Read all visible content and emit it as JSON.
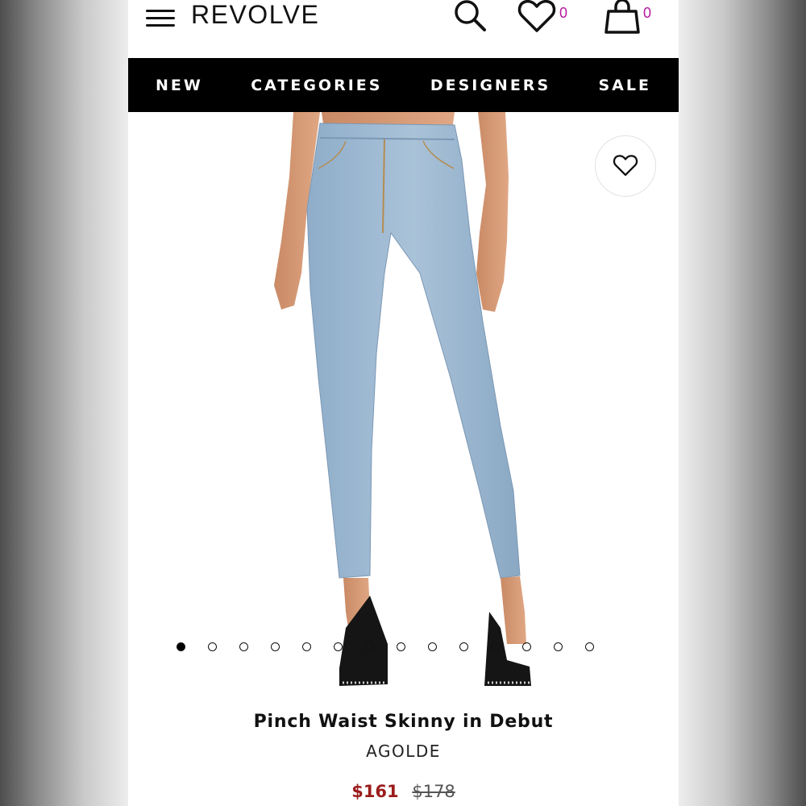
{
  "header": {
    "logo": "REVOLVE",
    "wishlist_count": "0",
    "cart_count": "0",
    "accent_color": "#b5179e"
  },
  "nav": {
    "items": [
      "NEW",
      "CATEGORIES",
      "DESIGNERS",
      "SALE"
    ]
  },
  "gallery": {
    "image_count": 14,
    "active_index": 0
  },
  "product": {
    "name": "Pinch Waist Skinny in Debut",
    "brand": "AGOLDE",
    "sale_price": "$161",
    "original_price": "$178",
    "sale_color": "#9b1c1c"
  },
  "icons": {
    "menu": "hamburger-menu-icon",
    "search": "search-icon",
    "wishlist": "heart-icon",
    "cart": "shopping-bag-icon",
    "favorite": "heart-outline-icon"
  }
}
